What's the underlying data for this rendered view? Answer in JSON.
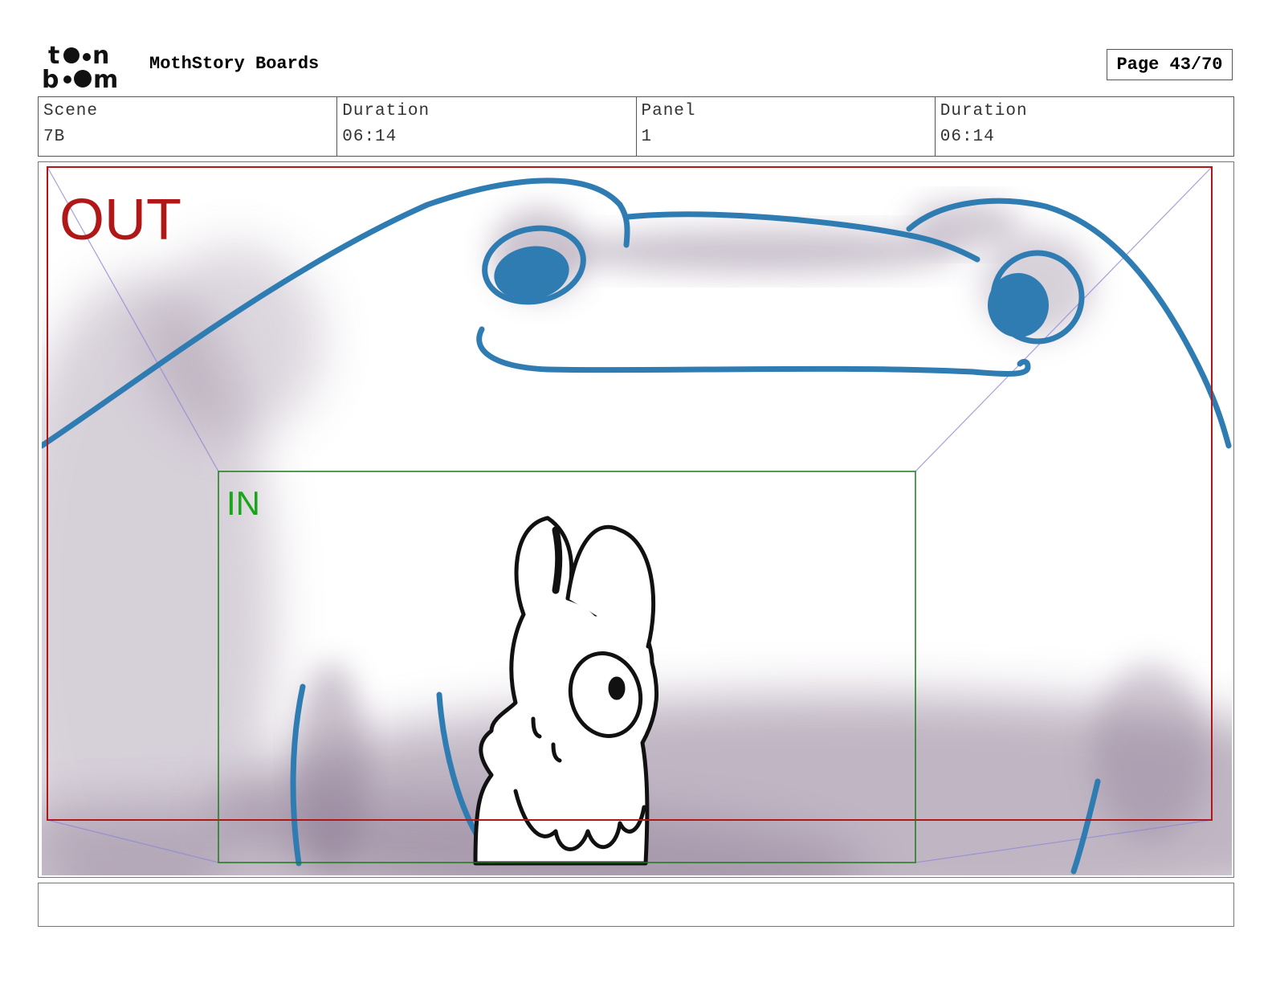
{
  "header": {
    "logo_text_top": "toon",
    "logo_text_bottom": "boom",
    "title": "MothStory Boards",
    "page_label": "Page 43/70"
  },
  "info": [
    {
      "label": "Scene",
      "value": "7B"
    },
    {
      "label": "Duration",
      "value": "06:14"
    },
    {
      "label": "Panel",
      "value": "1"
    },
    {
      "label": "Duration",
      "value": "06:14"
    }
  ],
  "panel": {
    "out_label": "OUT",
    "in_label": "IN"
  },
  "notes": {
    "text": ""
  },
  "colors": {
    "out_frame": "#b01818",
    "in_frame": "#1a7a1a",
    "in_text": "#19a519",
    "sketch_blue": "#2f7cb3",
    "shadow": "#8c7a93"
  }
}
